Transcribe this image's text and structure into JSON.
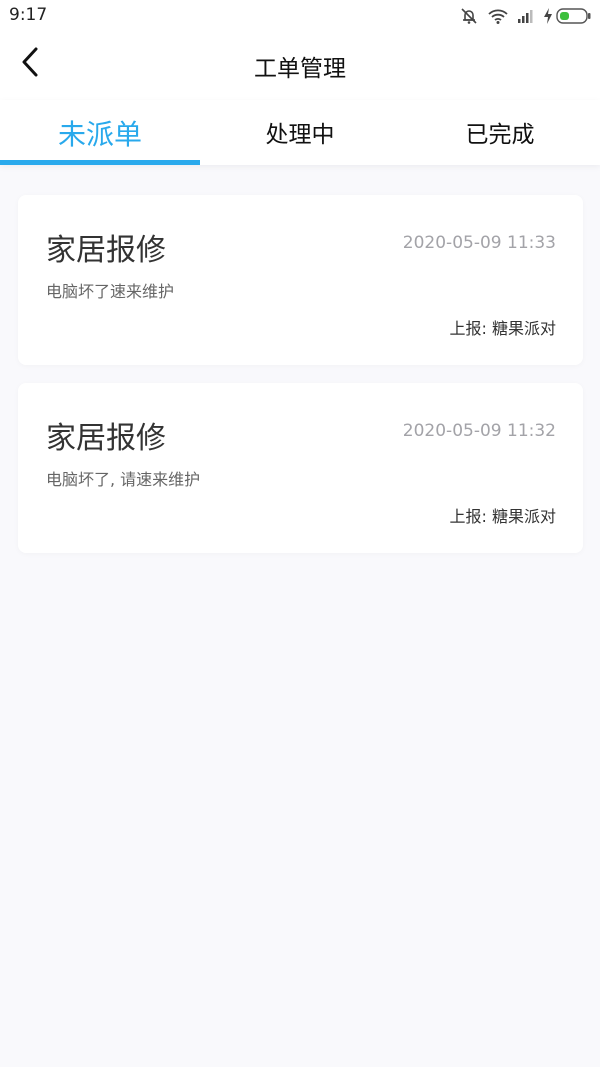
{
  "status_bar": {
    "time": "9:17",
    "icons": [
      "mute-icon",
      "wifi-icon",
      "signal-icon",
      "charging-icon",
      "battery-icon"
    ]
  },
  "header": {
    "title": "工单管理",
    "back_icon": "chevron-left-icon"
  },
  "tabs": [
    {
      "label": "未派单",
      "active": true
    },
    {
      "label": "处理中",
      "active": false
    },
    {
      "label": "已完成",
      "active": false
    }
  ],
  "colors": {
    "accent": "#29a9ec",
    "card_bg": "#ffffff",
    "page_bg": "#f9f9fc"
  },
  "orders": [
    {
      "title": "家居报修",
      "time": "2020-05-09 11:33",
      "description": "电脑坏了速来维护",
      "reporter": "上报: 糖果派对"
    },
    {
      "title": "家居报修",
      "time": "2020-05-09 11:32",
      "description": "电脑坏了, 请速来维护",
      "reporter": "上报: 糖果派对"
    }
  ]
}
